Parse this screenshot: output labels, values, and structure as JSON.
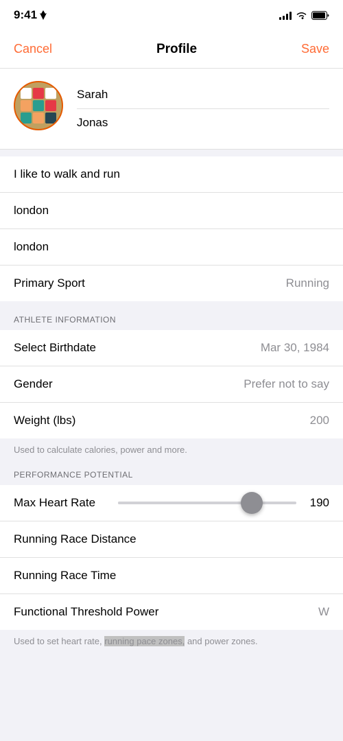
{
  "status_bar": {
    "time": "9:41",
    "signal_label": "signal",
    "wifi_label": "wifi",
    "battery_label": "battery"
  },
  "nav": {
    "cancel": "Cancel",
    "title": "Profile",
    "save": "Save"
  },
  "profile": {
    "first_name": "Sarah",
    "last_name": "Jonas"
  },
  "bio_fields": [
    {
      "value": "I like to walk and run"
    },
    {
      "value": "london"
    },
    {
      "value": "london"
    }
  ],
  "primary_sport": {
    "label": "Primary Sport",
    "value": "Running"
  },
  "athlete_section": {
    "header": "ATHLETE INFORMATION",
    "items": [
      {
        "label": "Select Birthdate",
        "value": "Mar 30, 1984"
      },
      {
        "label": "Gender",
        "value": "Prefer not to say"
      },
      {
        "label": "Weight (lbs)",
        "value": "200"
      }
    ],
    "footer": "Used to calculate calories, power and more."
  },
  "performance_section": {
    "header": "PERFORMANCE POTENTIAL",
    "items": [
      {
        "label": "Max Heart Rate",
        "value": "190",
        "has_slider": true
      },
      {
        "label": "Running Race Distance",
        "value": ""
      },
      {
        "label": "Running Race Time",
        "value": ""
      },
      {
        "label": "Functional Threshold Power",
        "value": "W"
      }
    ],
    "footer_parts": [
      "Used to set heart rate, ",
      "running pace zones,",
      " and power zones."
    ]
  }
}
